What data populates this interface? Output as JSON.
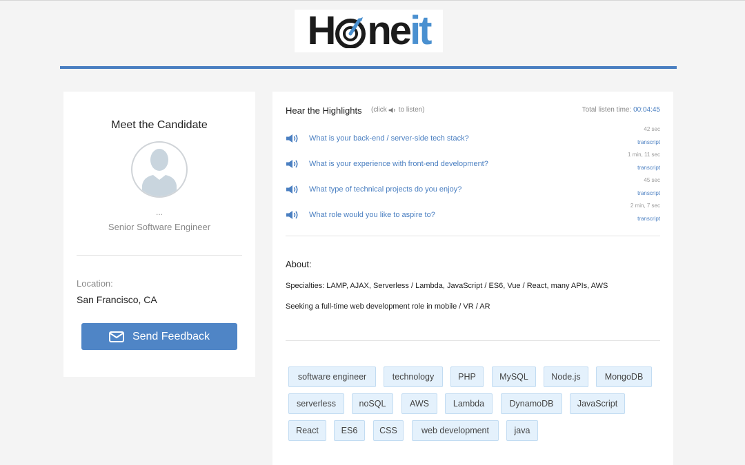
{
  "brand": {
    "name_prefix": "H",
    "name_middle": "ne",
    "name_suffix": "it",
    "accent": "#4a90d0"
  },
  "candidate": {
    "heading": "Meet the Candidate",
    "name": "...",
    "title": "Senior Software Engineer",
    "location_label": "Location:",
    "location": "San Francisco, CA",
    "feedback_button": "Send Feedback"
  },
  "highlights": {
    "title": "Hear the Highlights",
    "hint_before": "(click",
    "hint_after": "to listen)",
    "total_label": "Total listen time:",
    "total_value": "00:04:45",
    "questions": [
      {
        "text": "What is your back-end / server-side tech stack?",
        "duration": "42 sec",
        "transcript": "transcript"
      },
      {
        "text": "What is your experience with front-end development?",
        "duration": "1 min, 11 sec",
        "transcript": "transcript"
      },
      {
        "text": "What type of technical projects do you enjoy?",
        "duration": "45 sec",
        "transcript": "transcript"
      },
      {
        "text": "What role would you like to aspire to?",
        "duration": "2 min, 7 sec",
        "transcript": "transcript"
      }
    ]
  },
  "about": {
    "label": "About:",
    "specialties": "Specialties: LAMP, AJAX, Serverless / Lambda, JavaScript / ES6, Vue / React, many APIs, AWS",
    "seeking": "Seeking a full-time web development role in mobile / VR / AR"
  },
  "tags": [
    "software engineer",
    "technology",
    "PHP",
    "MySQL",
    "Node.js",
    "MongoDB",
    "serverless",
    "noSQL",
    "AWS",
    "Lambda",
    "DynamoDB",
    "JavaScript",
    "React",
    "ES6",
    "CSS",
    "web development",
    "java"
  ]
}
